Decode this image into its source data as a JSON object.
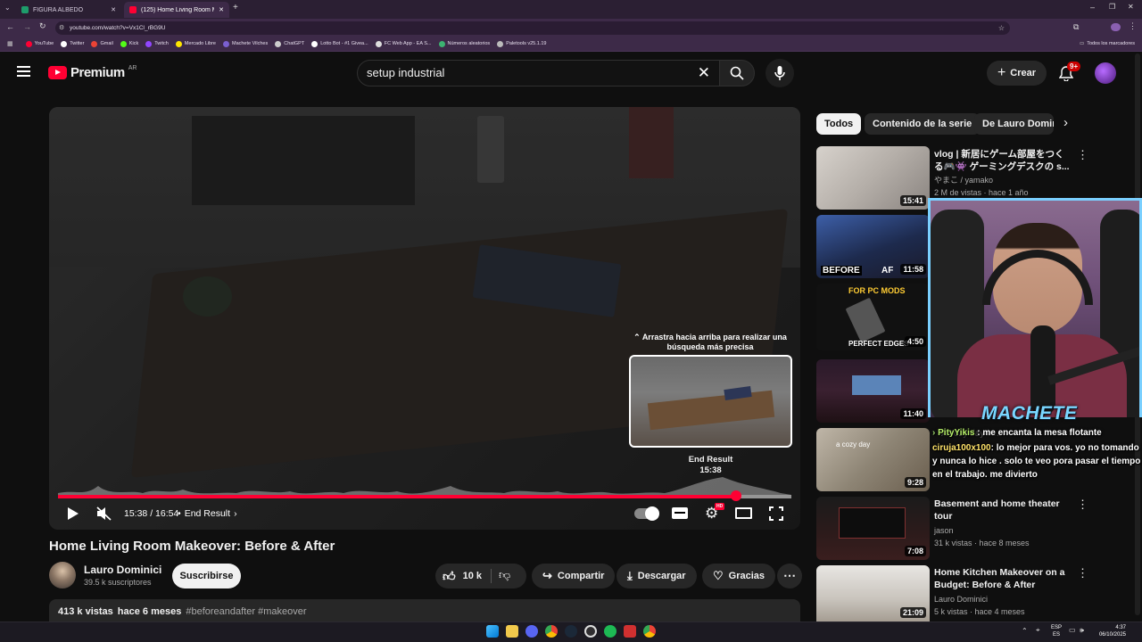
{
  "tabs": [
    {
      "label": "FIGURA ALBEDO"
    },
    {
      "label": "(125) Home Living Room Make"
    }
  ],
  "address": "youtube.com/watch?v=Vx1Cl_rBG9U",
  "bookmarks": [
    "YouTube",
    "Twitter",
    "Gmail",
    "Kick",
    "Twitch",
    "Mercado Libre",
    "Machete Vilches",
    "ChatGPT",
    "Lotto Bot - #1 Givea...",
    "FC Web App - EA S...",
    "Números aleatorios",
    "Paletools v25.1.19"
  ],
  "bookmarks_all": "Todos los marcadores",
  "header": {
    "logo": "Premium",
    "region": "AR",
    "search_value": "setup industrial",
    "create": "Crear",
    "notif": "9+"
  },
  "player": {
    "time": "15:38 / 16:54",
    "chapter": "End Result",
    "swipe_hint_1": "Arrastra hacia arriba para realizar una",
    "swipe_hint_2": "búsqueda más precisa",
    "preview_title": "End Result",
    "preview_time": "15:38",
    "progress": 0.925
  },
  "video": {
    "title": "Home Living Room Makeover: Before & After",
    "channel": "Lauro Dominici",
    "subs": "39.5 k suscriptores",
    "subscribe": "Suscribirse",
    "likes": "10 k",
    "share": "Compartir",
    "download": "Descargar",
    "thanks": "Gracias",
    "views": "413 k vistas",
    "ago": "hace 6 meses",
    "tags": "#beforeandafter #makeover"
  },
  "chips": [
    "Todos",
    "Contenido de la serie",
    "De Lauro Domini"
  ],
  "recs": [
    {
      "title1": "vlog | 新居にゲーム部屋をつく",
      "title2": "る🎮👾 ゲーミングデスクの s...",
      "channel": "やまこ / yamako",
      "meta": "2 M de vistas · hace 1 año",
      "dur": "15:41"
    },
    {
      "dur": "11:58",
      "thumb_text": "BEFORE",
      "thumb_text2": "AF"
    },
    {
      "dur": "4:50",
      "thumb_text": "FOR PC MODS",
      "thumb_text2": "PERFECT EDGES"
    },
    {
      "dur": "11:40"
    },
    {
      "dur": "9:28",
      "thumb_text": "a cozy day"
    },
    {
      "title1": "Basement and home theater",
      "title2": "tour",
      "channel": "jason",
      "meta": "31 k vistas · hace 8 meses",
      "dur": "7:08"
    },
    {
      "title1": "Home Kitchen Makeover on a",
      "title2": "Budget: Before & After",
      "channel": "Lauro Dominici",
      "meta": "5 k vistas · hace 4 meses",
      "dur": "21:09"
    }
  ],
  "webcam": {
    "name": "MACHETE",
    "chat_line1_user": "PityYikis",
    "chat_line1": " : me encanta la mesa flotante",
    "chat_line2_user": "ciruja100x100",
    "chat_line2": ": lo mejor para vos. yo no tomando y nunca lo hice . solo te veo pora pasar el tiempo en el trabajo. me divierto",
    "chat_faded": "A cozy day in..."
  },
  "taskbar": {
    "lang1": "ESP",
    "lang2": "ES",
    "time": "4:37",
    "date": "06/10/2025"
  },
  "colors": {
    "accent": "#ff0033",
    "webcam_border": "#7ad0ff",
    "name_color": "#7ad6ff"
  }
}
